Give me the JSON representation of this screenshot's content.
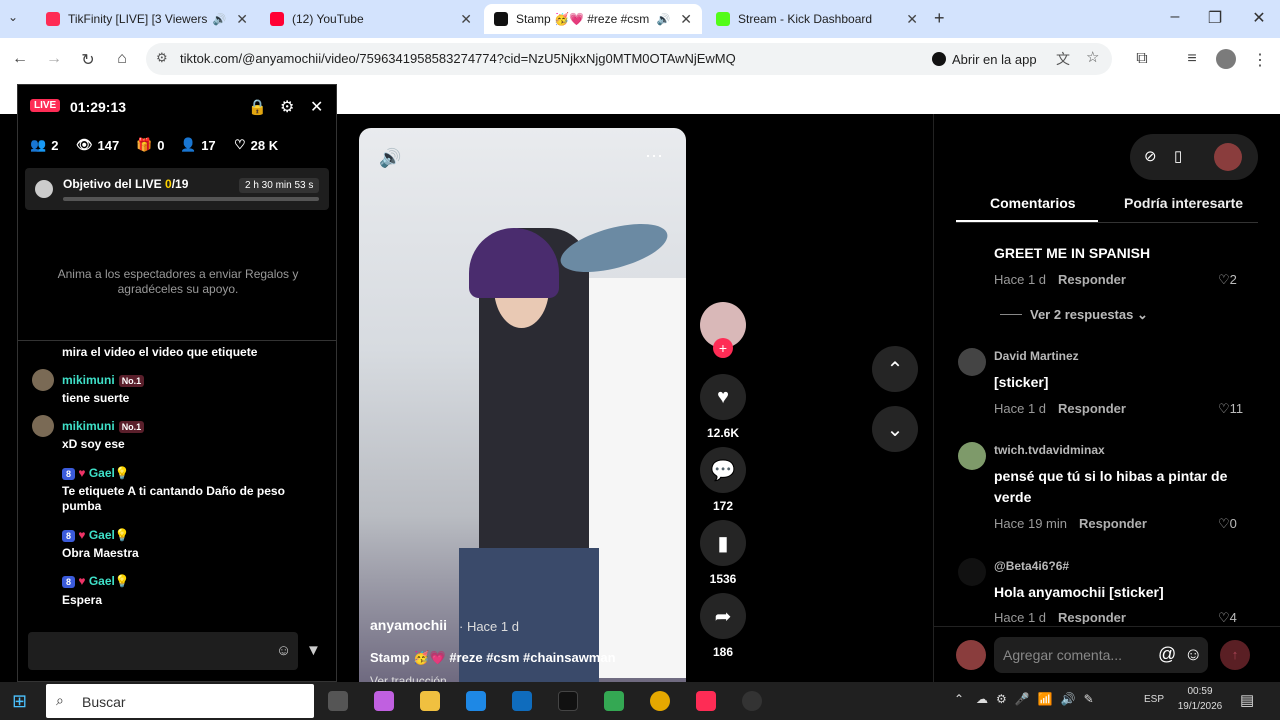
{
  "browser": {
    "tabs": [
      {
        "title": "TikFinity [LIVE] [3 Viewers]",
        "color": "#fe2c55"
      },
      {
        "title": "(12) YouTube",
        "color": "#ff0033"
      },
      {
        "title": "Stamp 🥳💗 #reze #csm #",
        "color": "#111111"
      },
      {
        "title": "Stream - Kick Dashboard",
        "color": "#53fc18"
      }
    ],
    "url": "tiktok.com/@anyamochii/video/7596341958583274774?cid=NzU5NjkxNjg0MTM0OTAwNjEwMQ",
    "open_in_app": "Abrir en la app"
  },
  "overlay": {
    "live_label": "LIVE",
    "timer": "01:29:13",
    "stats": {
      "viewers": "2",
      "views": "147",
      "gifts": "0",
      "follows": "17",
      "likes": "28 K"
    },
    "goal": {
      "label": "Objetivo del LIVE",
      "progress": "0",
      "target": "/19",
      "time": "2 h 30 min 53 s",
      "fraction": 0
    },
    "empty_text": "Anima a los espectadores a enviar Regalos y agradéceles su apoyo.",
    "chat": [
      {
        "text": "mira el video el video que etiquete"
      },
      {
        "user": "mikimuni",
        "badge": "No.1",
        "text": "tiene suerte"
      },
      {
        "user": "mikimuni",
        "badge": "No.1",
        "text": "xD soy ese"
      },
      {
        "level": "8",
        "user": "Gael💡",
        "text": "Te etiquete A ti cantando Daño de peso pumba"
      },
      {
        "level": "8",
        "user": "Gael💡",
        "text": "Obra Maestra"
      },
      {
        "level": "8",
        "user": "Gael💡",
        "text": "Espera"
      }
    ]
  },
  "video": {
    "author": "anyamochii",
    "time": "· Hace 1 d",
    "caption": "Stamp 🥳💗 #reze #csm #chainsawman",
    "translate": "Ver traducción",
    "likes": "12.6K",
    "comments": "172",
    "saves": "1536",
    "shares": "186"
  },
  "comments_panel": {
    "tab_comments": "Comentarios",
    "tab_interest": "Podría interesarte",
    "reply_label": "Responder",
    "see_replies": "Ver 2 respuestas",
    "input_placeholder": "Agregar comenta...",
    "items": [
      {
        "text": "GREET ME IN SPANISH",
        "time": "Hace 1 d",
        "likes": "2"
      },
      {
        "user": "David Martinez",
        "text": "[sticker]",
        "time": "Hace 1 d",
        "likes": "11"
      },
      {
        "user": "twich.tvdavidminax",
        "text": "pensé que tú si lo hibas a pintar de verde",
        "time": "Hace 19 min",
        "likes": "0"
      },
      {
        "user": "@Beta4i6?6#",
        "text": "Hola anyamochii [sticker]",
        "time": "Hace 1 d",
        "likes": "4"
      }
    ]
  },
  "taskbar": {
    "search": "Buscar",
    "lang": "ESP",
    "time": "00:59",
    "date": "19/1/2026"
  }
}
